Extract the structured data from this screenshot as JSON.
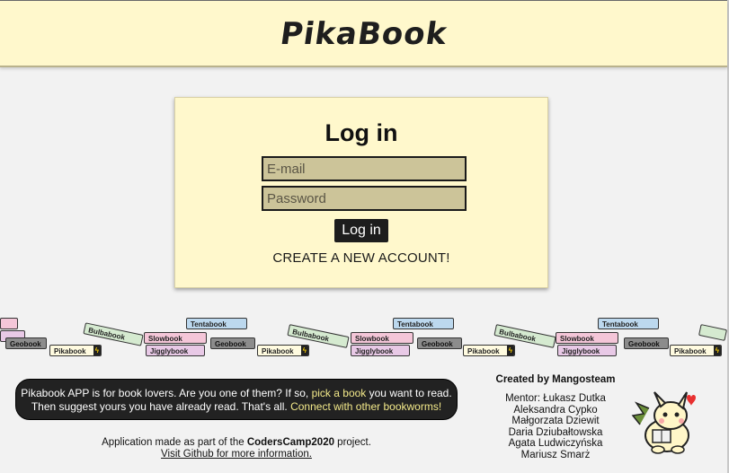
{
  "header": {
    "logo_text": "PikaBook"
  },
  "login": {
    "title": "Log in",
    "email_placeholder": "E-mail",
    "password_placeholder": "Password",
    "submit_label": "Log in",
    "create_account_label": "CREATE A NEW ACCOUNT!"
  },
  "shelf": {
    "books": [
      "Tentabook",
      "Slowbook",
      "Bulbabook",
      "Geobook",
      "Pikabook",
      "Jigglybook"
    ]
  },
  "footer": {
    "intro_1": "Pikabook APP is for book lovers. Are you one of them? If so, ",
    "pick_link": "pick a book",
    "intro_2": " you want to read.",
    "intro_3": "Then suggest yours you have already read. That's all. ",
    "connect_link": "Connect with other bookworms!",
    "made_prefix": "Application made as part of the ",
    "made_project": "CodersCamp2020",
    "made_suffix": " project.",
    "github_link": "Visit Github for more information."
  },
  "team": {
    "title": "Created by Mangosteam",
    "members": [
      "Mentor: Łukasz Dutka",
      "Aleksandra Cypko",
      "Małgorzata Dziewit",
      "Daria Dziubałtowska",
      "Agata Ludwiczyńska",
      "Mariusz Smarż"
    ]
  },
  "colors": {
    "accent_cream": "#fff8cc",
    "field_fill": "#ccc499",
    "dark": "#222222",
    "link_highlight": "#f3e98a"
  }
}
